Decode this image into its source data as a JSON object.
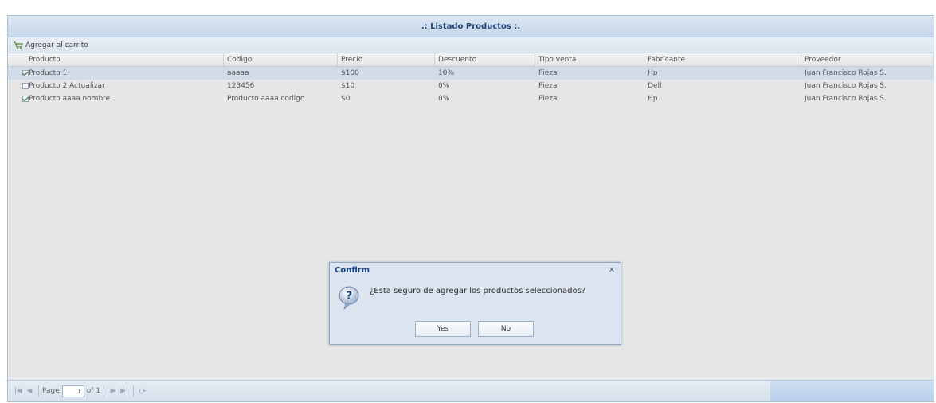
{
  "panel": {
    "title": ".: Listado Productos :."
  },
  "toolbar": {
    "add_to_cart_label": "Agregar al carrito"
  },
  "grid": {
    "columns": [
      "Producto",
      "Codigo",
      "Precio",
      "Descuento",
      "Tipo venta",
      "Fabricante",
      "Proveedor"
    ],
    "rows": [
      {
        "checked": true,
        "selected": true,
        "cells": [
          "Producto 1",
          "aaaaa",
          "$100",
          "10%",
          "Pieza",
          "Hp",
          "Juan Francisco Rojas S."
        ]
      },
      {
        "checked": false,
        "selected": false,
        "cells": [
          "Producto 2 Actualizar",
          "123456",
          "$10",
          "0%",
          "Pieza",
          "Dell",
          "Juan Francisco Rojas S."
        ]
      },
      {
        "checked": true,
        "selected": false,
        "cells": [
          "Producto aaaa nombre",
          "Producto aaaa codigo",
          "$0",
          "0%",
          "Pieza",
          "Hp",
          "Juan Francisco Rojas S."
        ]
      }
    ]
  },
  "pager": {
    "page_label": "Page",
    "page_value": "1",
    "of_label": "of 1"
  },
  "dialog": {
    "title": "Confirm",
    "message": "¿Esta seguro de agregar los productos seleccionados?",
    "yes_label": "Yes",
    "no_label": "No"
  },
  "colors": {
    "accent": "#15428b",
    "header_bg": "#c6d6ea",
    "selected_row": "#d2dbe8"
  }
}
